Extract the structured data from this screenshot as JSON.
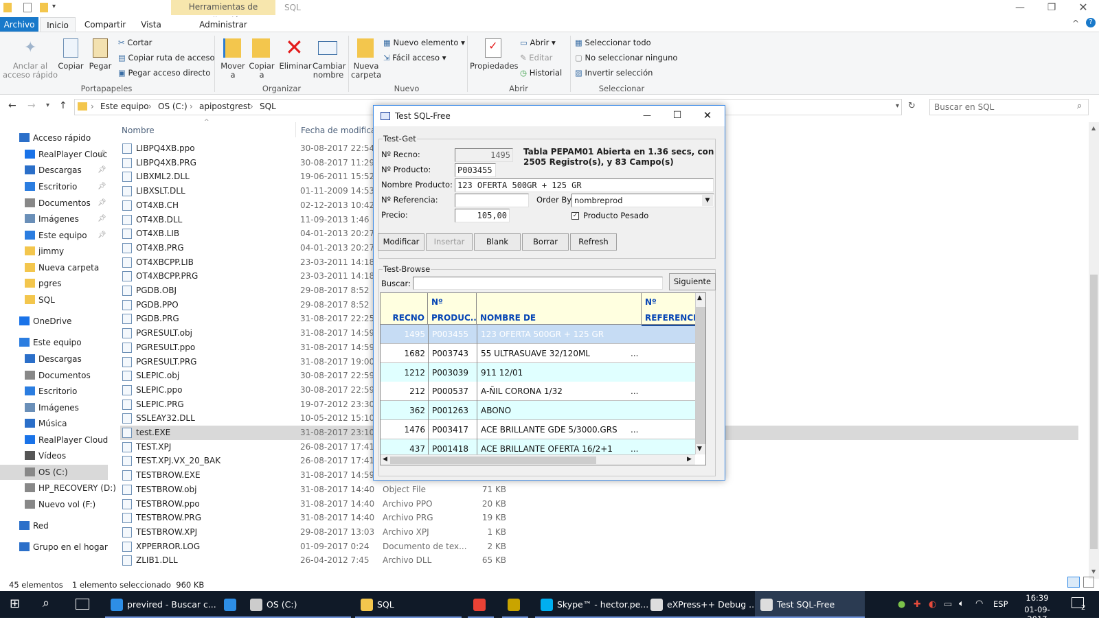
{
  "window": {
    "title": "SQL",
    "tools_tab": "Herramientas de aplicación"
  },
  "tabs": {
    "archivo": "Archivo",
    "inicio": "Inicio",
    "compartir": "Compartir",
    "vista": "Vista",
    "administrar": "Administrar"
  },
  "ribbon": {
    "anclar": "Anclar al acceso rápido",
    "copiar": "Copiar",
    "pegar": "Pegar",
    "cortar": "Cortar",
    "copiar_ruta": "Copiar ruta de acceso",
    "pegar_acceso": "Pegar acceso directo",
    "portapapeles": "Portapapeles",
    "mover": "Mover a",
    "copiar_a": "Copiar a",
    "eliminar": "Eliminar",
    "cambiar": "Cambiar nombre",
    "organizar": "Organizar",
    "nueva_carpeta": "Nueva carpeta",
    "nuevo_elemento": "Nuevo elemento",
    "facil": "Fácil acceso",
    "nuevo": "Nuevo",
    "propiedades": "Propiedades",
    "abrir_btn": "Abrir",
    "editar": "Editar",
    "historial": "Historial",
    "abrir": "Abrir",
    "sel_todo": "Seleccionar todo",
    "no_sel": "No seleccionar ninguno",
    "invertir": "Invertir selección",
    "seleccionar": "Seleccionar"
  },
  "address": {
    "crumbs": [
      "Este equipo",
      "OS (C:)",
      "apipostgrest",
      "SQL"
    ],
    "search_placeholder": "Buscar en SQL"
  },
  "nav": [
    {
      "label": "Acceso rápido",
      "pin": false
    },
    {
      "label": "RealPlayer Clouc",
      "pin": true
    },
    {
      "label": "Descargas",
      "pin": true
    },
    {
      "label": "Escritorio",
      "pin": true
    },
    {
      "label": "Documentos",
      "pin": true
    },
    {
      "label": "Imágenes",
      "pin": true
    },
    {
      "label": "Este equipo",
      "pin": true
    },
    {
      "label": "jimmy",
      "pin": false
    },
    {
      "label": "Nueva carpeta",
      "pin": false
    },
    {
      "label": "pgres",
      "pin": false
    },
    {
      "label": "SQL",
      "pin": false
    },
    {
      "label": "OneDrive",
      "pin": false
    },
    {
      "label": "Este equipo",
      "pin": false
    },
    {
      "label": "Descargas",
      "pin": false
    },
    {
      "label": "Documentos",
      "pin": false
    },
    {
      "label": "Escritorio",
      "pin": false
    },
    {
      "label": "Imágenes",
      "pin": false
    },
    {
      "label": "Música",
      "pin": false
    },
    {
      "label": "RealPlayer Cloud",
      "pin": false
    },
    {
      "label": "Vídeos",
      "pin": false
    },
    {
      "label": "OS (C:)",
      "pin": false
    },
    {
      "label": "HP_RECOVERY (D:)",
      "pin": false
    },
    {
      "label": "Nuevo vol (F:)",
      "pin": false
    },
    {
      "label": "Red",
      "pin": false
    },
    {
      "label": "Grupo en el hogar",
      "pin": false
    }
  ],
  "columns": {
    "name": "Nombre",
    "date": "Fecha de modifica..."
  },
  "files": [
    {
      "name": "LIBPQ4XB.ppo",
      "date": "30-08-2017 22:54",
      "type": "",
      "size": ""
    },
    {
      "name": "LIBPQ4XB.PRG",
      "date": "30-08-2017 11:29",
      "type": "",
      "size": ""
    },
    {
      "name": "LIBXML2.DLL",
      "date": "19-06-2011 15:52",
      "type": "",
      "size": ""
    },
    {
      "name": "LIBXSLT.DLL",
      "date": "01-11-2009 14:53",
      "type": "",
      "size": ""
    },
    {
      "name": "OT4XB.CH",
      "date": "02-12-2013 10:42",
      "type": "",
      "size": ""
    },
    {
      "name": "OT4XB.DLL",
      "date": "11-09-2013 1:46",
      "type": "",
      "size": ""
    },
    {
      "name": "OT4XB.LIB",
      "date": "04-01-2013 20:27",
      "type": "",
      "size": ""
    },
    {
      "name": "OT4XB.PRG",
      "date": "04-01-2013 20:27",
      "type": "",
      "size": ""
    },
    {
      "name": "OT4XBCPP.LIB",
      "date": "23-03-2011 14:18",
      "type": "",
      "size": ""
    },
    {
      "name": "OT4XBCPP.PRG",
      "date": "23-03-2011 14:18",
      "type": "",
      "size": ""
    },
    {
      "name": "PGDB.OBJ",
      "date": "29-08-2017 8:52",
      "type": "",
      "size": ""
    },
    {
      "name": "PGDB.PPO",
      "date": "29-08-2017 8:52",
      "type": "",
      "size": ""
    },
    {
      "name": "PGDB.PRG",
      "date": "31-08-2017 22:25",
      "type": "",
      "size": ""
    },
    {
      "name": "PGRESULT.obj",
      "date": "31-08-2017 14:59",
      "type": "",
      "size": ""
    },
    {
      "name": "PGRESULT.ppo",
      "date": "31-08-2017 14:59",
      "type": "",
      "size": ""
    },
    {
      "name": "PGRESULT.PRG",
      "date": "31-08-2017 19:00",
      "type": "",
      "size": ""
    },
    {
      "name": "SLEPIC.obj",
      "date": "30-08-2017 22:59",
      "type": "",
      "size": ""
    },
    {
      "name": "SLEPIC.ppo",
      "date": "30-08-2017 22:59",
      "type": "",
      "size": ""
    },
    {
      "name": "SLEPIC.PRG",
      "date": "19-07-2012 23:30",
      "type": "",
      "size": ""
    },
    {
      "name": "SSLEAY32.DLL",
      "date": "10-05-2012 15:10",
      "type": "",
      "size": ""
    },
    {
      "name": "test.EXE",
      "date": "31-08-2017 23:10",
      "type": "",
      "size": "",
      "selected": true
    },
    {
      "name": "TEST.XPJ",
      "date": "26-08-2017 17:41",
      "type": "",
      "size": ""
    },
    {
      "name": "TEST.XPJ.VX_20_BAK",
      "date": "26-08-2017 17:41",
      "type": "",
      "size": ""
    },
    {
      "name": "TESTBROW.EXE",
      "date": "31-08-2017 14:59",
      "type": "Aplicación",
      "size": "449 KB"
    },
    {
      "name": "TESTBROW.obj",
      "date": "31-08-2017 14:40",
      "type": "Object File",
      "size": "71 KB"
    },
    {
      "name": "TESTBROW.ppo",
      "date": "31-08-2017 14:40",
      "type": "Archivo PPO",
      "size": "20 KB"
    },
    {
      "name": "TESTBROW.PRG",
      "date": "31-08-2017 14:40",
      "type": "Archivo PRG",
      "size": "19 KB"
    },
    {
      "name": "TESTBROW.XPJ",
      "date": "29-08-2017 13:03",
      "type": "Archivo XPJ",
      "size": "1 KB"
    },
    {
      "name": "XPPERROR.LOG",
      "date": "01-09-2017 0:24",
      "type": "Documento de tex...",
      "size": "2 KB"
    },
    {
      "name": "ZLIB1.DLL",
      "date": "26-04-2012 7:45",
      "type": "Archivo DLL",
      "size": "65 KB"
    }
  ],
  "status": {
    "count": "45 elementos",
    "selected": "1 elemento seleccionado  960 KB"
  },
  "dialog": {
    "title": "Test SQL-Free",
    "get_group": "Test-Get",
    "recno_label": "Nº Recno:",
    "recno": "1495",
    "producto_label": "Nº Producto:",
    "producto": "P003455",
    "nombre_label": "Nombre Producto:",
    "nombre": "123 OFERTA 500GR + 125 GR",
    "referencia_label": "Nº Referencia:",
    "referencia": "",
    "precio_label": "Precio:",
    "precio": "105,00",
    "orderby_label": "Order By:",
    "orderby": "nombreprod",
    "pesado_label": "Producto Pesado",
    "info": "Tabla PEPAM01 Abierta en 1.36 secs, con 2505 Registro(s), y 83 Campo(s)",
    "buttons": {
      "modificar": "Modificar",
      "insertar": "Insertar",
      "blank": "Blank",
      "borrar": "Borrar",
      "refresh": "Refresh"
    },
    "browse_group": "Test-Browse",
    "buscar_label": "Buscar:",
    "buscar": "",
    "siguiente": "Siguiente",
    "headers": {
      "recno": "RECNO",
      "producto_1": "Nº",
      "producto_2": "PRODUC...",
      "nombre": "NOMBRE DE",
      "ref_1": "Nº",
      "ref_2": "REFERENCIA"
    },
    "rows": [
      {
        "recno": "1495",
        "producto": "P003455",
        "nombre": "123 OFERTA 500GR + 125 GR",
        "more": ""
      },
      {
        "recno": "1682",
        "producto": "P003743",
        "nombre": "55 ULTRASUAVE 32/120ML",
        "more": "..."
      },
      {
        "recno": "1212",
        "producto": "P003039",
        "nombre": "911  12/01",
        "more": ""
      },
      {
        "recno": "212",
        "producto": "P000537",
        "nombre": "A-ÑIL CORONA 1/32",
        "more": "..."
      },
      {
        "recno": "362",
        "producto": "P001263",
        "nombre": "ABONO",
        "more": ""
      },
      {
        "recno": "1476",
        "producto": "P003417",
        "nombre": "ACE BRILLANTE GDE 5/3000.GRS",
        "more": "..."
      },
      {
        "recno": "437",
        "producto": "P001418",
        "nombre": "ACE BRILLANTE OFERTA 16/2+1",
        "more": "..."
      }
    ]
  },
  "taskbar": {
    "items": [
      "previred - Buscar c...",
      "OS (C:)",
      "SQL",
      "Skype™ - hector.pe...",
      "eXPress++ Debug ...",
      "Test SQL-Free"
    ],
    "lang": "ESP",
    "time": "16:39",
    "date": "01-09-2017",
    "notif": "2"
  },
  "colors": {
    "accent": "#1979ca",
    "grid_selected": "#c6dcf4",
    "grid_alt": "#e0ffff",
    "grid_header": "#ffffe0",
    "header_text": "#0645b5"
  }
}
